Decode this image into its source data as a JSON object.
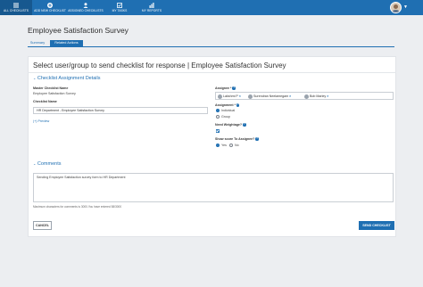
{
  "nav": {
    "items": [
      {
        "label": "ALL CHECKLISTS",
        "icon": "list-icon"
      },
      {
        "label": "ADD NEW CHECKLIST",
        "icon": "plus-icon"
      },
      {
        "label": "ASSIGNED CHECKLISTS",
        "icon": "user-check-icon"
      },
      {
        "label": "MY TASKS",
        "icon": "tasks-icon"
      },
      {
        "label": "MY REPORTS",
        "icon": "reports-icon"
      }
    ],
    "active_index": 0
  },
  "page": {
    "title": "Employee Satisfaction Survey"
  },
  "tabs": [
    {
      "label": "Summary"
    },
    {
      "label": "Related Actions"
    }
  ],
  "card": {
    "title": "Select user/group to send checklist for response | Employee Satisfaction Survey"
  },
  "assignment": {
    "section_title": "Checklist Assignment Details",
    "master_label": "Master Checklist Name",
    "master_value": "Employee Satisfaction Survey",
    "checklist_label": "Checklist Name",
    "checklist_value": "HR Department - Employee Satisfaction Survey",
    "preview_link": "(+) Preview",
    "assignee_label": "Assignee",
    "assignees": [
      "Lakshmi P",
      "Surendran Neelamegam",
      "Bob Marley"
    ],
    "assignment_label": "Assignment",
    "assignment_options": [
      "Individual",
      "Group"
    ],
    "assignment_selected": "Individual",
    "weightage_label": "Need Weightage?",
    "weightage_checked": true,
    "score_label": "Show score To Assignee?",
    "score_options": [
      "Yes",
      "No"
    ],
    "score_selected": "Yes"
  },
  "comments": {
    "section_title": "Comments",
    "value": "Sending Employee Satisfaction survey form to HR Department",
    "helper": "Maximum characters for comments is 3000.You have entered 58/3000"
  },
  "actions": {
    "cancel_label": "CANCEL",
    "send_label": "SEND CHECKLIST"
  },
  "colors": {
    "primary": "#1f6fb2",
    "nav_active": "#17588f",
    "background": "#eceef1"
  }
}
